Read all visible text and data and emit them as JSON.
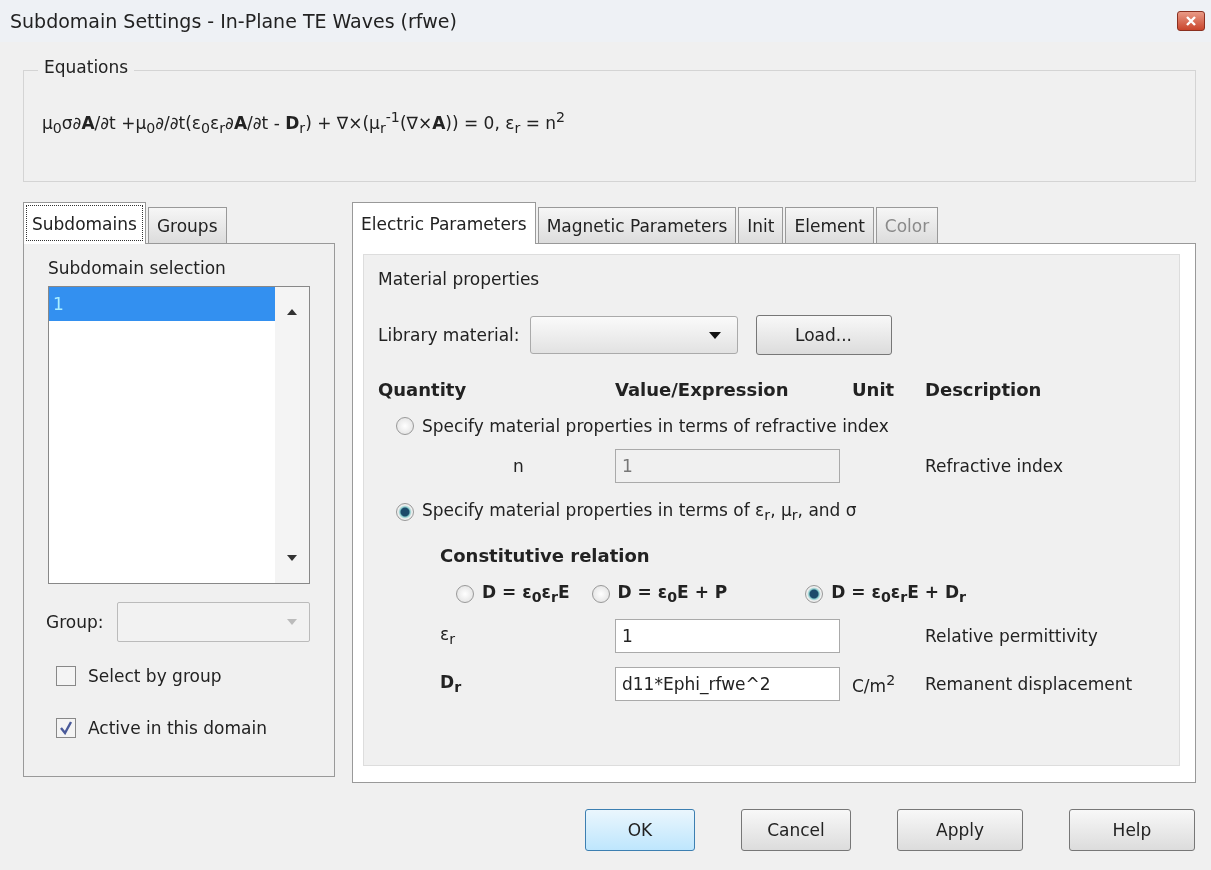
{
  "window": {
    "title": "Subdomain Settings - In-Plane TE Waves (rfwe)"
  },
  "equations": {
    "label": "Equations",
    "text": "μ$_{0}$σ∂**A**/∂t +μ$_{0}$∂/∂t(ε$_{0}$ε$_{r}$∂**A**/∂t - **D**$_{r}$) + ∇×(μ$_{r}$$^{-1}$(∇×**A**)) = 0, ε$_{r}$ = n$^{2}$"
  },
  "left_tabs": [
    {
      "label": "Subdomains",
      "selected": true
    },
    {
      "label": "Groups",
      "selected": false
    }
  ],
  "subdomain_selection": {
    "label": "Subdomain selection",
    "items": [
      {
        "label": "1",
        "selected": true
      }
    ]
  },
  "group": {
    "label": "Group:",
    "disabled": true
  },
  "checkboxes": [
    {
      "label": "Select by group",
      "checked": false
    },
    {
      "label": "Active in this domain",
      "checked": true
    }
  ],
  "tabs": [
    {
      "label": "Electric Parameters",
      "selected": true,
      "disabled": false
    },
    {
      "label": "Magnetic Parameters",
      "selected": false,
      "disabled": false
    },
    {
      "label": "Init",
      "selected": false,
      "disabled": false
    },
    {
      "label": "Element",
      "selected": false,
      "disabled": false
    },
    {
      "label": "Color",
      "selected": false,
      "disabled": true
    }
  ],
  "material": {
    "label": "Material properties",
    "library_label": "Library material:",
    "load_button": "Load..."
  },
  "headers": [
    "Quantity",
    "Value/Expression",
    "Unit",
    "Description"
  ],
  "spec_options": [
    {
      "label": "Specify material properties in terms of refractive index",
      "selected": false
    },
    {
      "label": "Specify material properties in terms of ε$_{r}$, μ$_{r}$, and σ",
      "selected": true
    }
  ],
  "refractive_row": {
    "quantity": "n",
    "value": "1",
    "description": "Refractive index",
    "disabled": true
  },
  "constitutive": {
    "label": "Constitutive relation",
    "options": [
      {
        "label": "D = ε$_{0}$ε$_{r}$E",
        "selected": false
      },
      {
        "label": "D = ε$_{0}$E + P",
        "selected": false
      },
      {
        "label": "D = ε$_{0}$ε$_{r}$E + D$_{r}$",
        "selected": true
      }
    ]
  },
  "params": [
    {
      "quantity": "ε$_{r}$",
      "bold": false,
      "value": "1",
      "description": "Relative permittivity"
    },
    {
      "quantity": "D$_{r}$",
      "bold": true,
      "value": "d11*Ephi_rfwe^2",
      "unit": "C/m$^{2}$",
      "description": "Remanent displacement"
    }
  ],
  "buttons": [
    {
      "label": "OK",
      "default": true
    },
    {
      "label": "Cancel",
      "default": false
    },
    {
      "label": "Apply",
      "default": false
    },
    {
      "label": "Help",
      "default": false
    }
  ]
}
